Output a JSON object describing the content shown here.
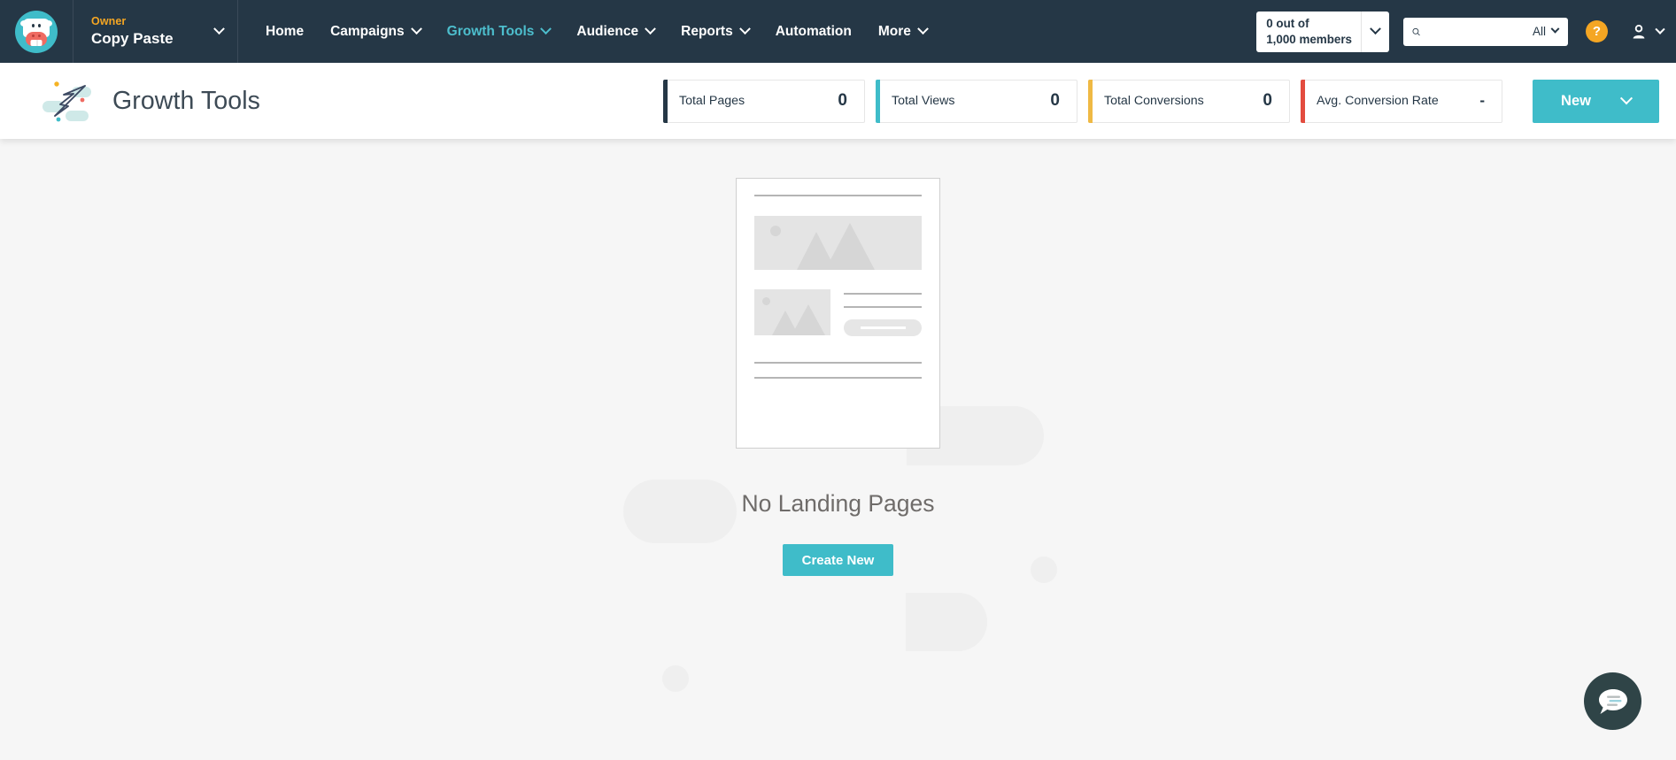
{
  "topnav": {
    "avatar_name": "cow-avatar",
    "account": {
      "role": "Owner",
      "name": "Copy Paste"
    },
    "items": [
      {
        "label": "Home",
        "has_caret": false,
        "active": false
      },
      {
        "label": "Campaigns",
        "has_caret": true,
        "active": false
      },
      {
        "label": "Growth Tools",
        "has_caret": true,
        "active": true
      },
      {
        "label": "Audience",
        "has_caret": true,
        "active": false
      },
      {
        "label": "Reports",
        "has_caret": true,
        "active": false
      },
      {
        "label": "Automation",
        "has_caret": false,
        "active": false
      },
      {
        "label": "More",
        "has_caret": true,
        "active": false
      }
    ],
    "members": {
      "line1": "0 out of",
      "line2": "1,000 members"
    },
    "search": {
      "value": "",
      "placeholder": "",
      "filter_label": "All"
    },
    "help_label": "?",
    "accent_teal": "#4dbecd",
    "accent_orange": "#f5a623",
    "bar_background": "#253746"
  },
  "subheader": {
    "title": "Growth Tools",
    "stats": [
      {
        "label": "Total Pages",
        "value": "0",
        "accent": "#253746"
      },
      {
        "label": "Total Views",
        "value": "0",
        "accent": "#3fbcc9"
      },
      {
        "label": "Total Conversions",
        "value": "0",
        "accent": "#efb944"
      },
      {
        "label": "Avg. Conversion Rate",
        "value": "-",
        "accent": "#e34c3f"
      }
    ],
    "new_button": "New"
  },
  "main": {
    "empty_title": "No Landing Pages",
    "create_button": "Create New"
  },
  "chat": {
    "label": "chat-bubble"
  }
}
